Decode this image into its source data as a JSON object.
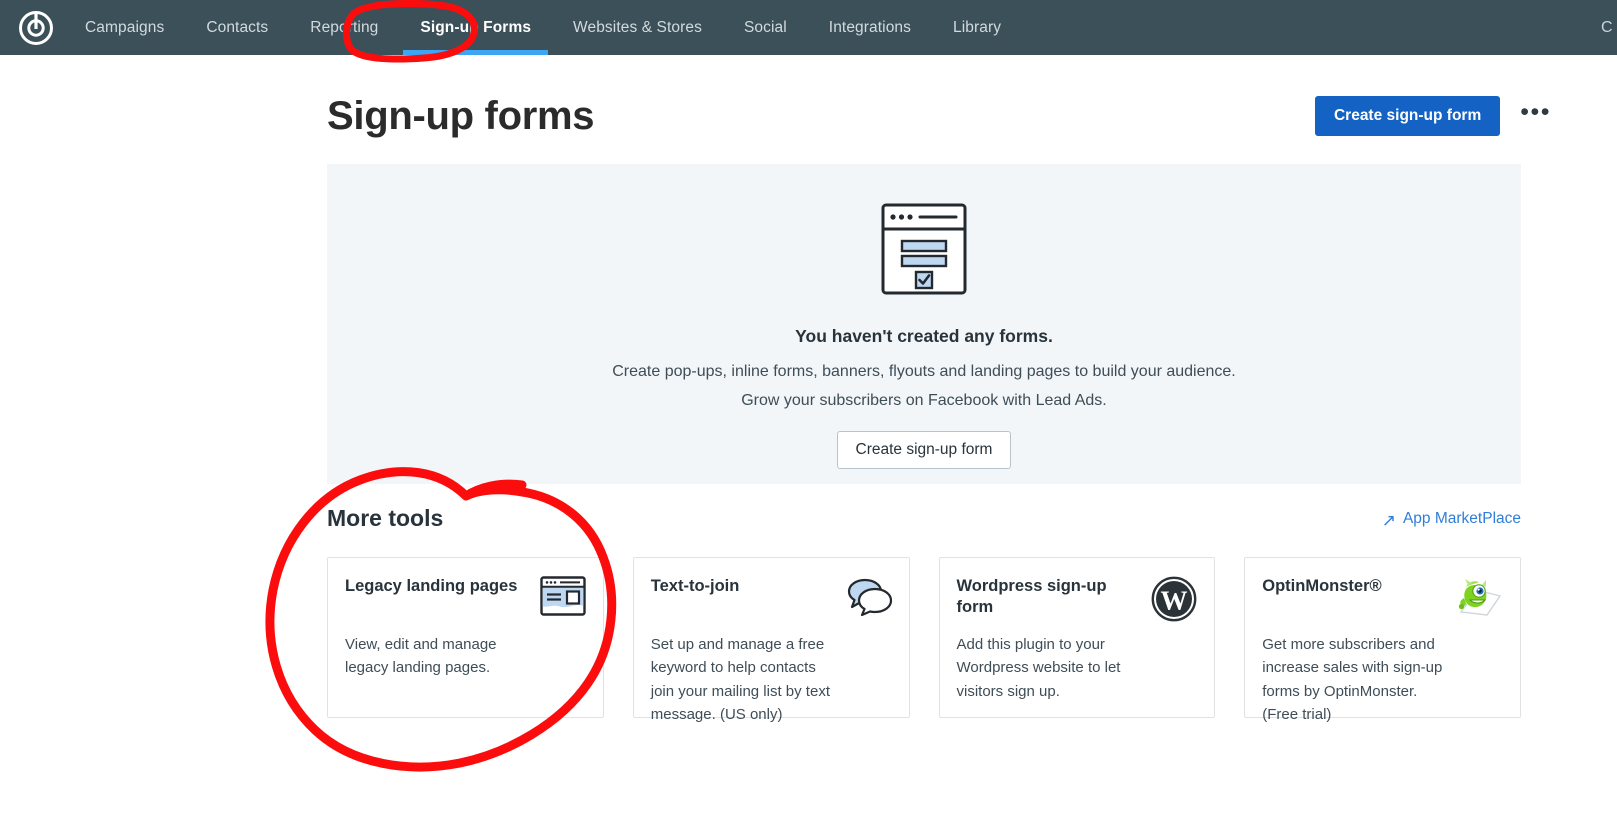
{
  "nav": {
    "logo_icon": "constant-contact-logo-icon",
    "items": [
      {
        "label": "Campaigns",
        "active": false
      },
      {
        "label": "Contacts",
        "active": false
      },
      {
        "label": "Reporting",
        "active": false
      },
      {
        "label": "Sign-up Forms",
        "active": true
      },
      {
        "label": "Websites & Stores",
        "active": false
      },
      {
        "label": "Social",
        "active": false
      },
      {
        "label": "Integrations",
        "active": false
      },
      {
        "label": "Library",
        "active": false
      }
    ],
    "edge_clipped_label": "C"
  },
  "header": {
    "title": "Sign-up forms",
    "create_button": "Create sign-up form",
    "more_menu": "•••"
  },
  "empty_state": {
    "illustration_icon": "signup-form-window-icon",
    "heading": "You haven't created any forms.",
    "line1": "Create pop-ups, inline forms, banners, flyouts and landing pages to build your audience.",
    "line2": "Grow your subscribers on Facebook with Lead Ads.",
    "button": "Create sign-up form"
  },
  "more_tools": {
    "title": "More tools",
    "marketplace_link": "App MarketPlace",
    "marketplace_icon": "arrow-up-right-icon",
    "cards": [
      {
        "name": "Legacy landing pages",
        "desc": "View, edit and manage legacy landing pages.",
        "icon": "landing-page-window-icon"
      },
      {
        "name": "Text-to-join",
        "desc": "Set up and manage a free keyword to help contacts join your mailing list by text message. (US only)",
        "icon": "speech-bubbles-icon"
      },
      {
        "name": "Wordpress sign-up form",
        "desc": "Add this plugin to your Wordpress website to let visitors sign up.",
        "icon": "wordpress-logo-icon"
      },
      {
        "name": "OptinMonster®",
        "desc": "Get more subscribers and increase sales with sign-up forms by OptinMonster. (Free trial)",
        "icon": "optinmonster-mascot-icon"
      }
    ]
  },
  "annotations": {
    "color": "#fc0d0d",
    "marks": [
      {
        "name": "nav-tab-circle",
        "target": "Sign-up Forms tab"
      },
      {
        "name": "legacy-landing-pages-circle",
        "target": "Legacy landing pages card"
      }
    ]
  },
  "colors": {
    "nav_bg": "#3c5059",
    "accent_blue": "#1463c4",
    "tab_underline": "#3da5f4",
    "panel_bg": "#f2f6f9",
    "link_blue": "#2f7ed8",
    "annotation_red": "#fc0d0d"
  }
}
